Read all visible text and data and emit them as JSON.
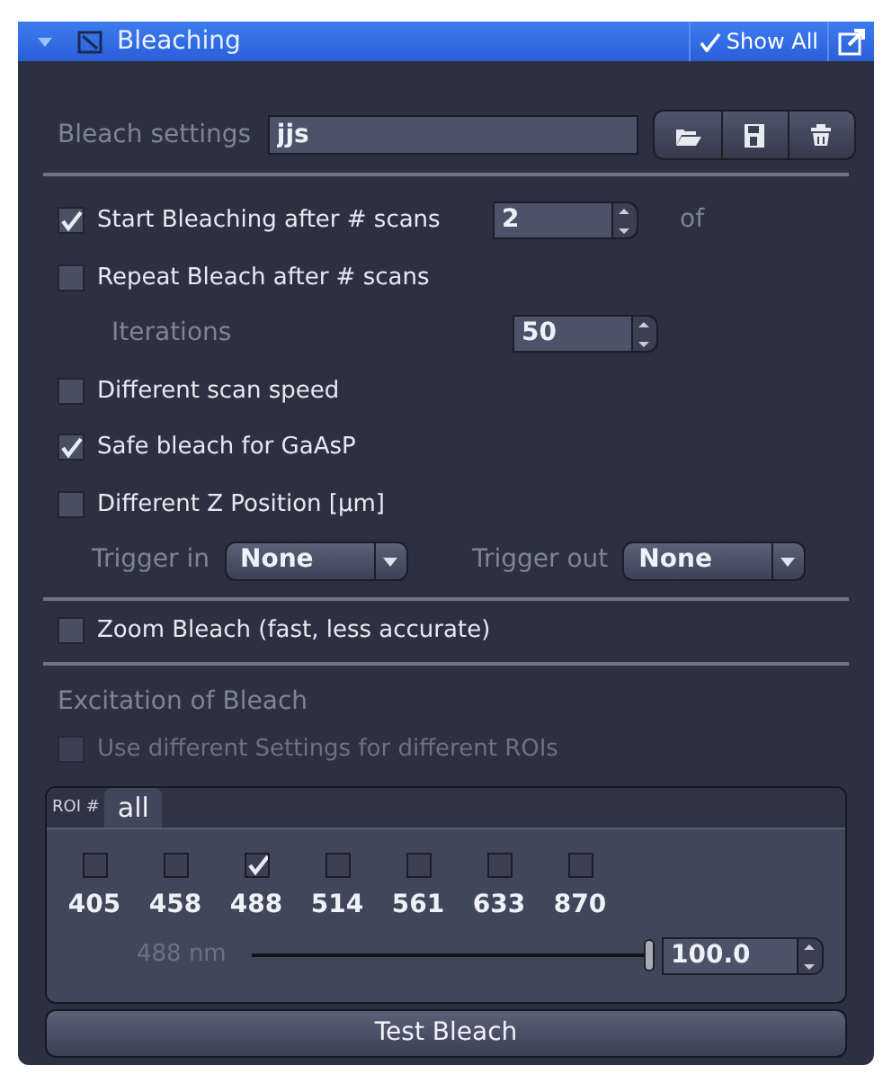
{
  "header": {
    "title": "Bleaching",
    "expanded": true,
    "show_all": "Show All"
  },
  "bleach_settings": {
    "label": "Bleach settings",
    "value": "jjs"
  },
  "options": [
    {
      "kind": "checkbox",
      "label": "Start Bleaching after # scans",
      "checked": true,
      "spinner": "2",
      "suffix": "of"
    },
    {
      "kind": "checkbox",
      "label": "Repeat Bleach after # scans",
      "checked": false
    },
    {
      "kind": "spinner",
      "label": "Iterations",
      "value": "50"
    },
    {
      "kind": "checkbox",
      "label": "Different scan speed",
      "checked": false
    },
    {
      "kind": "checkbox",
      "label": "Safe bleach for GaAsP",
      "checked": true
    },
    {
      "kind": "checkbox",
      "label": "Different Z Position [µm]",
      "checked": false
    },
    {
      "kind": "triggers",
      "triggers": [
        {
          "label": "Trigger in",
          "value": "None"
        },
        {
          "label": "Trigger out",
          "value": "None"
        }
      ]
    }
  ],
  "zoom_bleach": {
    "label": "Zoom Bleach (fast, less accurate)",
    "checked": false
  },
  "excitation": {
    "title": "Excitation of Bleach",
    "use_different": {
      "label": "Use different Settings for different ROIs",
      "checked": false,
      "disabled": true
    },
    "roi_label": "ROI #",
    "tabs": [
      {
        "label": "all",
        "selected": true
      }
    ],
    "lasers": [
      {
        "wavelength": "405",
        "checked": false
      },
      {
        "wavelength": "458",
        "checked": false
      },
      {
        "wavelength": "488",
        "checked": true
      },
      {
        "wavelength": "514",
        "checked": false
      },
      {
        "wavelength": "561",
        "checked": false
      },
      {
        "wavelength": "633",
        "checked": false
      },
      {
        "wavelength": "870",
        "checked": false
      }
    ],
    "slider": {
      "label": "488 nm",
      "level": 1.0,
      "value": "100.0"
    }
  },
  "test_button": "Test Bleach"
}
